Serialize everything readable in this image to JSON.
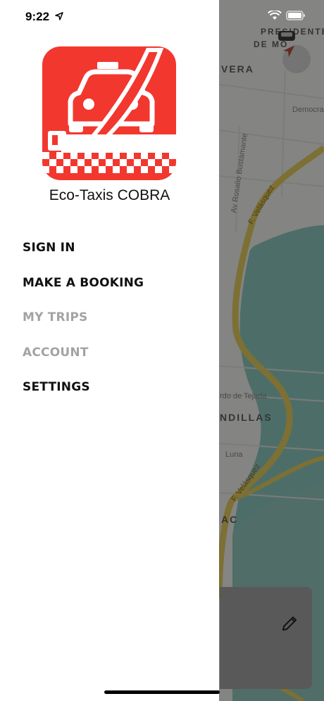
{
  "status_bar": {
    "time": "9:22"
  },
  "brand": {
    "name": "Eco-Taxis COBRA",
    "logo_bg": "#f2372f"
  },
  "menu": [
    {
      "label": "SIGN IN",
      "state": "enabled"
    },
    {
      "label": "MAKE A BOOKING",
      "state": "enabled"
    },
    {
      "label": "MY TRIPS",
      "state": "disabled"
    },
    {
      "label": "ACCOUNT",
      "state": "disabled"
    },
    {
      "label": "SETTINGS",
      "state": "enabled"
    }
  ],
  "map": {
    "labels": {
      "vera": "VERA",
      "de_mo": "DE MO",
      "democrac": "Democrac",
      "rosalio": "Av Rosalio Bustamante",
      "velasquez_top": "F. Velásquez",
      "tejada": "rdo de Tejada",
      "ndillas": "NDILLAS",
      "luna": "Luna",
      "velasquez_bottom": "F. Velásquez",
      "ac": "AC",
      "presidente": "PRESIDENTE"
    }
  },
  "icons": {
    "compass": "navigation-arrow-icon",
    "car": "car-icon",
    "edit": "pencil-icon"
  },
  "colors": {
    "road": "#d8c25a",
    "water": "#7fb7ae",
    "drawer_bg": "#ffffff",
    "disabled_text": "#a3a3a3"
  }
}
